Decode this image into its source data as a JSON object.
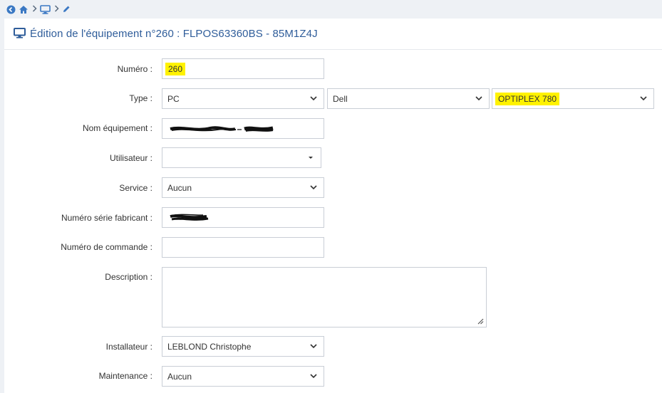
{
  "nav": {
    "back_icon": "back-circle-icon",
    "home_icon": "home-icon",
    "computer_icon": "computer-icon",
    "edit_icon": "pencil-icon"
  },
  "header": {
    "icon": "computer-icon",
    "title": "Édition de l'équipement n°260 : FLPOS63360BS - 85M1Z4J"
  },
  "form": {
    "numero": {
      "label": "Numéro :",
      "value": "260"
    },
    "type": {
      "label": "Type :",
      "type_value": "PC",
      "brand_value": "Dell",
      "model_value": "OPTIPLEX 780"
    },
    "nom": {
      "label": "Nom équipement :"
    },
    "utilisateur": {
      "label": "Utilisateur :",
      "value": ""
    },
    "service": {
      "label": "Service :",
      "value": "Aucun"
    },
    "serie": {
      "label": "Numéro série fabricant :"
    },
    "commande": {
      "label": "Numéro de commande :",
      "value": ""
    },
    "description": {
      "label": "Description :",
      "value": ""
    },
    "installateur": {
      "label": "Installateur :",
      "value": "LEBLOND Christophe"
    },
    "maintenance": {
      "label": "Maintenance :",
      "value": "Aucun"
    }
  },
  "colors": {
    "accent": "#2f5d9a",
    "highlight": "#fff200",
    "border": "#c9ced6"
  }
}
